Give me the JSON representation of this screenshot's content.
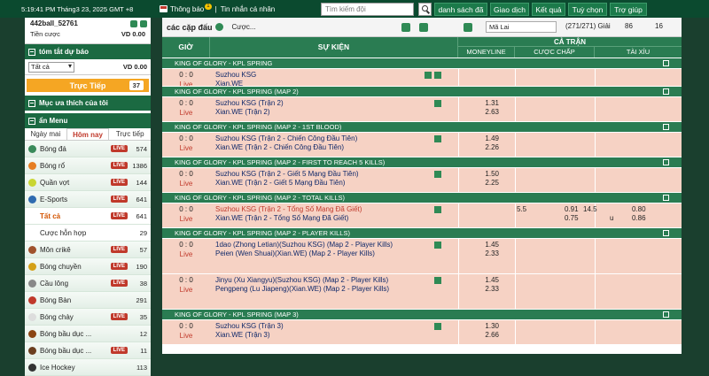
{
  "topbar": {
    "time": "5:19:41 PM Tháng3 23, 2025 GMT +8",
    "notif_label": "Thông báo",
    "notif_count": "1",
    "messages_label": "Tin nhắn cá nhân",
    "search_placeholder": "Tìm kiếm đội",
    "nav": [
      "danh sách đã cược",
      "Giao dịch",
      "Kết quả",
      "Tuỳ chọn",
      "Trợ giúp"
    ]
  },
  "sidebar": {
    "username": "442ball_52761",
    "bet_label": "Tiền cược",
    "bet_value": "VD 0.00",
    "summary_title": "tóm tắt dự báo",
    "filter": "Tất cả",
    "filter_value": "VD 0.00",
    "live_label": "Trực Tiếp",
    "live_count": "37",
    "favorites_title": "Mục ưa thích của tôi",
    "hide_menu": "ẩn Menu",
    "tabs": [
      "Ngày mai",
      "Hôm nay",
      "Trực tiếp"
    ],
    "sports": [
      {
        "name": "Bóng đá",
        "live": "LIVE",
        "count": "574",
        "icon": "soccer-ball-icon",
        "color": "#3a8a5a"
      },
      {
        "name": "Bóng rổ",
        "live": "LIVE",
        "count": "1386",
        "icon": "basketball-icon",
        "color": "#e67e22"
      },
      {
        "name": "Quần vợt",
        "live": "LIVE",
        "count": "144",
        "icon": "tennis-ball-icon",
        "color": "#c9d632"
      },
      {
        "name": "E-Sports",
        "live": "LIVE",
        "count": "641",
        "icon": "gamepad-icon",
        "color": "#2f6bb0"
      },
      {
        "name": "Tất cả",
        "live": "LIVE",
        "count": "641",
        "sub": true,
        "active": true
      },
      {
        "name": "Cược hỗn hợp",
        "live": "",
        "count": "29",
        "sub": true
      },
      {
        "name": "Môn crikê",
        "live": "LIVE",
        "count": "57",
        "icon": "cricket-icon",
        "color": "#a0522d"
      },
      {
        "name": "Bóng chuyền",
        "live": "LIVE",
        "count": "190",
        "icon": "volleyball-icon",
        "color": "#d4a017"
      },
      {
        "name": "Cầu lông",
        "live": "LIVE",
        "count": "38",
        "icon": "shuttlecock-icon",
        "color": "#888888"
      },
      {
        "name": "Bóng Bàn",
        "live": "",
        "count": "291",
        "icon": "table-tennis-icon",
        "color": "#c0392b"
      },
      {
        "name": "Bóng chày",
        "live": "LIVE",
        "count": "35",
        "icon": "baseball-icon",
        "color": "#dddddd"
      },
      {
        "name": "Bóng bầu dục ...",
        "live": "",
        "count": "12",
        "icon": "rugby-ball-icon",
        "color": "#8b4513"
      },
      {
        "name": "Bóng bầu dục ...",
        "live": "LIVE",
        "count": "11",
        "icon": "football-icon",
        "color": "#6b3e1f"
      },
      {
        "name": "Ice Hockey",
        "live": "",
        "count": "113",
        "icon": "hockey-icon",
        "color": "#333333"
      }
    ]
  },
  "main": {
    "title": "các cặp đấu",
    "bet_type": "Cược...",
    "odds_type": "Mã Lai",
    "count": "(271/271) Giải",
    "c1": "86",
    "c2": "16",
    "header": {
      "time": "GIỜ",
      "event": "SỰ KIỆN",
      "full": "CẢ TRẬN",
      "moneyline": "MONEYLINE",
      "handicap": "CƯỢC CHẤP",
      "overunder": "TÀI XỈU"
    },
    "sections": [
      {
        "league": "KING OF GLORY - KPL SPRING",
        "matches": [
          {
            "score": "0 : 0",
            "live": "Live",
            "home": "Suzhou KSG",
            "away": "Xian.WE",
            "ml1": "",
            "ml2": "",
            "tv": true,
            "h": 20
          }
        ]
      },
      {
        "league": "KING OF GLORY - KPL SPRING (MAP 2)",
        "matches": [
          {
            "score": "0 : 0",
            "live": "Live",
            "home": "Suzhou KSG (Trận 2)",
            "away": "Xian.WE (Trận 2)",
            "ml1": "1.31",
            "ml2": "2.63",
            "h": 28
          }
        ]
      },
      {
        "league": "KING OF GLORY - KPL SPRING (MAP 2 - 1ST BLOOD)",
        "matches": [
          {
            "score": "0 : 0",
            "live": "Live",
            "home": "Suzhou KSG (Trận 2 - Chiến Công Đầu Tiên)",
            "away": "Xian.WE (Trận 2 - Chiến Công Đầu Tiên)",
            "ml1": "1.49",
            "ml2": "2.26",
            "h": 28
          }
        ]
      },
      {
        "league": "KING OF GLORY - KPL SPRING (MAP 2 - FIRST TO REACH 5 KILLS)",
        "matches": [
          {
            "score": "0 : 0",
            "live": "Live",
            "home": "Suzhou KSG (Trận 2 - Giết 5 Mạng Đầu Tiên)",
            "away": "Xian.WE (Trận 2 - Giết 5 Mạng Đầu Tiên)",
            "ml1": "1.50",
            "ml2": "2.25",
            "h": 28
          }
        ]
      },
      {
        "league": "KING OF GLORY - KPL SPRING (MAP 2 - TOTAL KILLS)",
        "matches": [
          {
            "score": "0 : 0",
            "live": "Live",
            "home": "Suzhou KSG (Trận 2 - Tổng Số Mạng Đã Giết)",
            "away": "Xian.WE (Trận 2 - Tổng Số Mạng Đã Giết)",
            "ml1": "",
            "ml2": "",
            "red": true,
            "hdp": {
              "line": "5.5",
              "o1": "0.91",
              "ou_line": "14.5",
              "u": "u",
              "o2": "0.80",
              "b1": "0.75",
              "b2": "0.86"
            },
            "h": 28
          }
        ]
      },
      {
        "league": "KING OF GLORY - KPL SPRING (MAP 2 - PLAYER KILLS)",
        "matches": [
          {
            "score": "0 : 0",
            "live": "Live",
            "home": "1dao (Zhong Letian)(Suzhou KSG) (Map 2 - Player Kills)",
            "away": "Peien (Wen Shuai)(Xian.WE) (Map 2 - Player Kills)",
            "ml1": "1.45",
            "ml2": "2.33",
            "h": 40
          },
          {
            "score": "0 : 0",
            "live": "Live",
            "home": "Jinyu (Xu Xiangyu)(Suzhou KSG) (Map 2 - Player Kills)",
            "away": "Pengpeng (Lu Jiapeng)(Xian.WE) (Map 2 - Player Kills)",
            "ml1": "1.45",
            "ml2": "2.33",
            "h": 40
          }
        ]
      },
      {
        "league": "KING OF GLORY - KPL SPRING (MAP 3)",
        "matches": [
          {
            "score": "0 : 0",
            "live": "Live",
            "home": "Suzhou KSG (Trận 3)",
            "away": "Xian.WE (Trận 3)",
            "ml1": "1.30",
            "ml2": "2.66",
            "h": 28
          }
        ]
      }
    ]
  }
}
